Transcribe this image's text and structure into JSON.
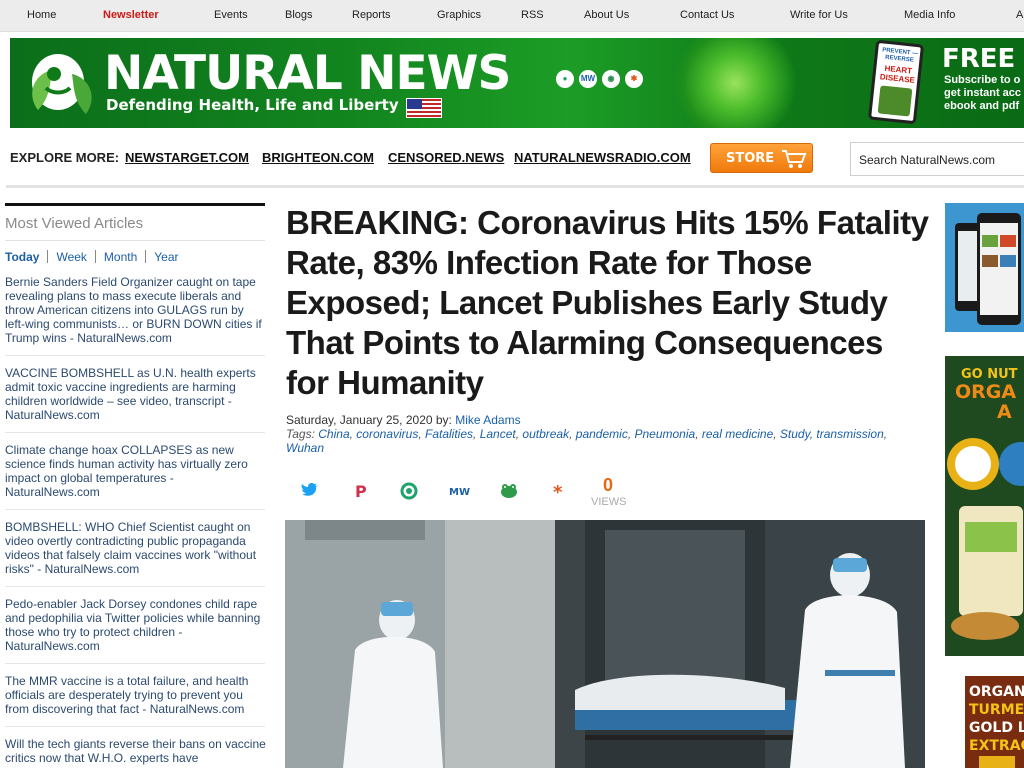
{
  "nav": {
    "items": [
      {
        "label": "Home"
      },
      {
        "label": "Newsletter"
      },
      {
        "label": "Events"
      },
      {
        "label": "Blogs"
      },
      {
        "label": "Reports"
      },
      {
        "label": "Graphics"
      },
      {
        "label": "RSS"
      },
      {
        "label": "About Us"
      },
      {
        "label": "Contact Us"
      },
      {
        "label": "Write for Us"
      },
      {
        "label": "Media Info"
      },
      {
        "label": "A"
      }
    ]
  },
  "banner": {
    "title": "NATURAL NEWS",
    "tagline": "Defending Health, Life and Liberty",
    "tablet_line1": "PREVENT — REVERSE",
    "tablet_line2": "HEART DISEASE",
    "promo_title": "FREE",
    "promo_text": "Subscribe to o get instant acc ebook and pdf"
  },
  "explore": {
    "label": "EXPLORE MORE:",
    "links": [
      {
        "label": "NEWSTARGET.COM"
      },
      {
        "label": "BRIGHTEON.COM"
      },
      {
        "label": "CENSORED.NEWS"
      },
      {
        "label": "NATURALNEWSRADIO.COM"
      }
    ],
    "store_label": "STORE"
  },
  "search": {
    "value": "Search NaturalNews.com"
  },
  "sidebar": {
    "title": "Most Viewed Articles",
    "tabs": [
      {
        "label": "Today"
      },
      {
        "label": "Week"
      },
      {
        "label": "Month"
      },
      {
        "label": "Year"
      }
    ],
    "articles": [
      {
        "title": "Bernie Sanders Field Organizer caught on tape revealing plans to mass execute liberals and throw American citizens into GULAGS run by left-wing communists… or BURN DOWN cities if Trump wins - NaturalNews.com"
      },
      {
        "title": "VACCINE BOMBSHELL as U.N. health experts admit toxic vaccine ingredients are harming children worldwide – see video, transcript - NaturalNews.com"
      },
      {
        "title": "Climate change hoax COLLAPSES as new science finds human activity has virtually zero impact on global temperatures - NaturalNews.com"
      },
      {
        "title": "BOMBSHELL: WHO Chief Scientist caught on video overtly contradicting public propaganda videos that falsely claim vaccines work \"without risks\" - NaturalNews.com"
      },
      {
        "title": "Pedo-enabler Jack Dorsey condones child rape and pedophilia via Twitter policies while banning those who try to protect children - NaturalNews.com"
      },
      {
        "title": "The MMR vaccine is a total failure, and health officials are desperately trying to prevent you from discovering that fact - NaturalNews.com"
      },
      {
        "title": "Will the tech giants reverse their bans on vaccine critics now that W.H.O. experts have"
      }
    ]
  },
  "article": {
    "headline": "BREAKING: Coronavirus Hits 15% Fatality Rate, 83% Infection Rate for Those Exposed; Lancet Publishes Early Study That Points to Alarming Consequences for Humanity",
    "date_by": "Saturday, January 25, 2020 by:",
    "author": "Mike Adams",
    "tags_label": "Tags:",
    "tags": [
      {
        "label": "China"
      },
      {
        "label": "coronavirus"
      },
      {
        "label": "Fatalities"
      },
      {
        "label": "Lancet"
      },
      {
        "label": "outbreak"
      },
      {
        "label": "pandemic"
      },
      {
        "label": "Pneumonia"
      },
      {
        "label": "real medicine"
      },
      {
        "label": "Study"
      },
      {
        "label": "transmission"
      },
      {
        "label": "Wuhan"
      }
    ],
    "views_count": "0",
    "views_label": "VIEWS"
  },
  "share": {
    "icons": [
      "twitter-icon",
      "pinterest-icon",
      "gab-icon",
      "mewe-icon",
      "parler-icon",
      "brighteon-icon"
    ]
  },
  "colors": {
    "link": "#1b5fa8",
    "accent_red": "#cc1a14",
    "store_orange": "#f07a0c",
    "banner_green": "#13861f"
  }
}
